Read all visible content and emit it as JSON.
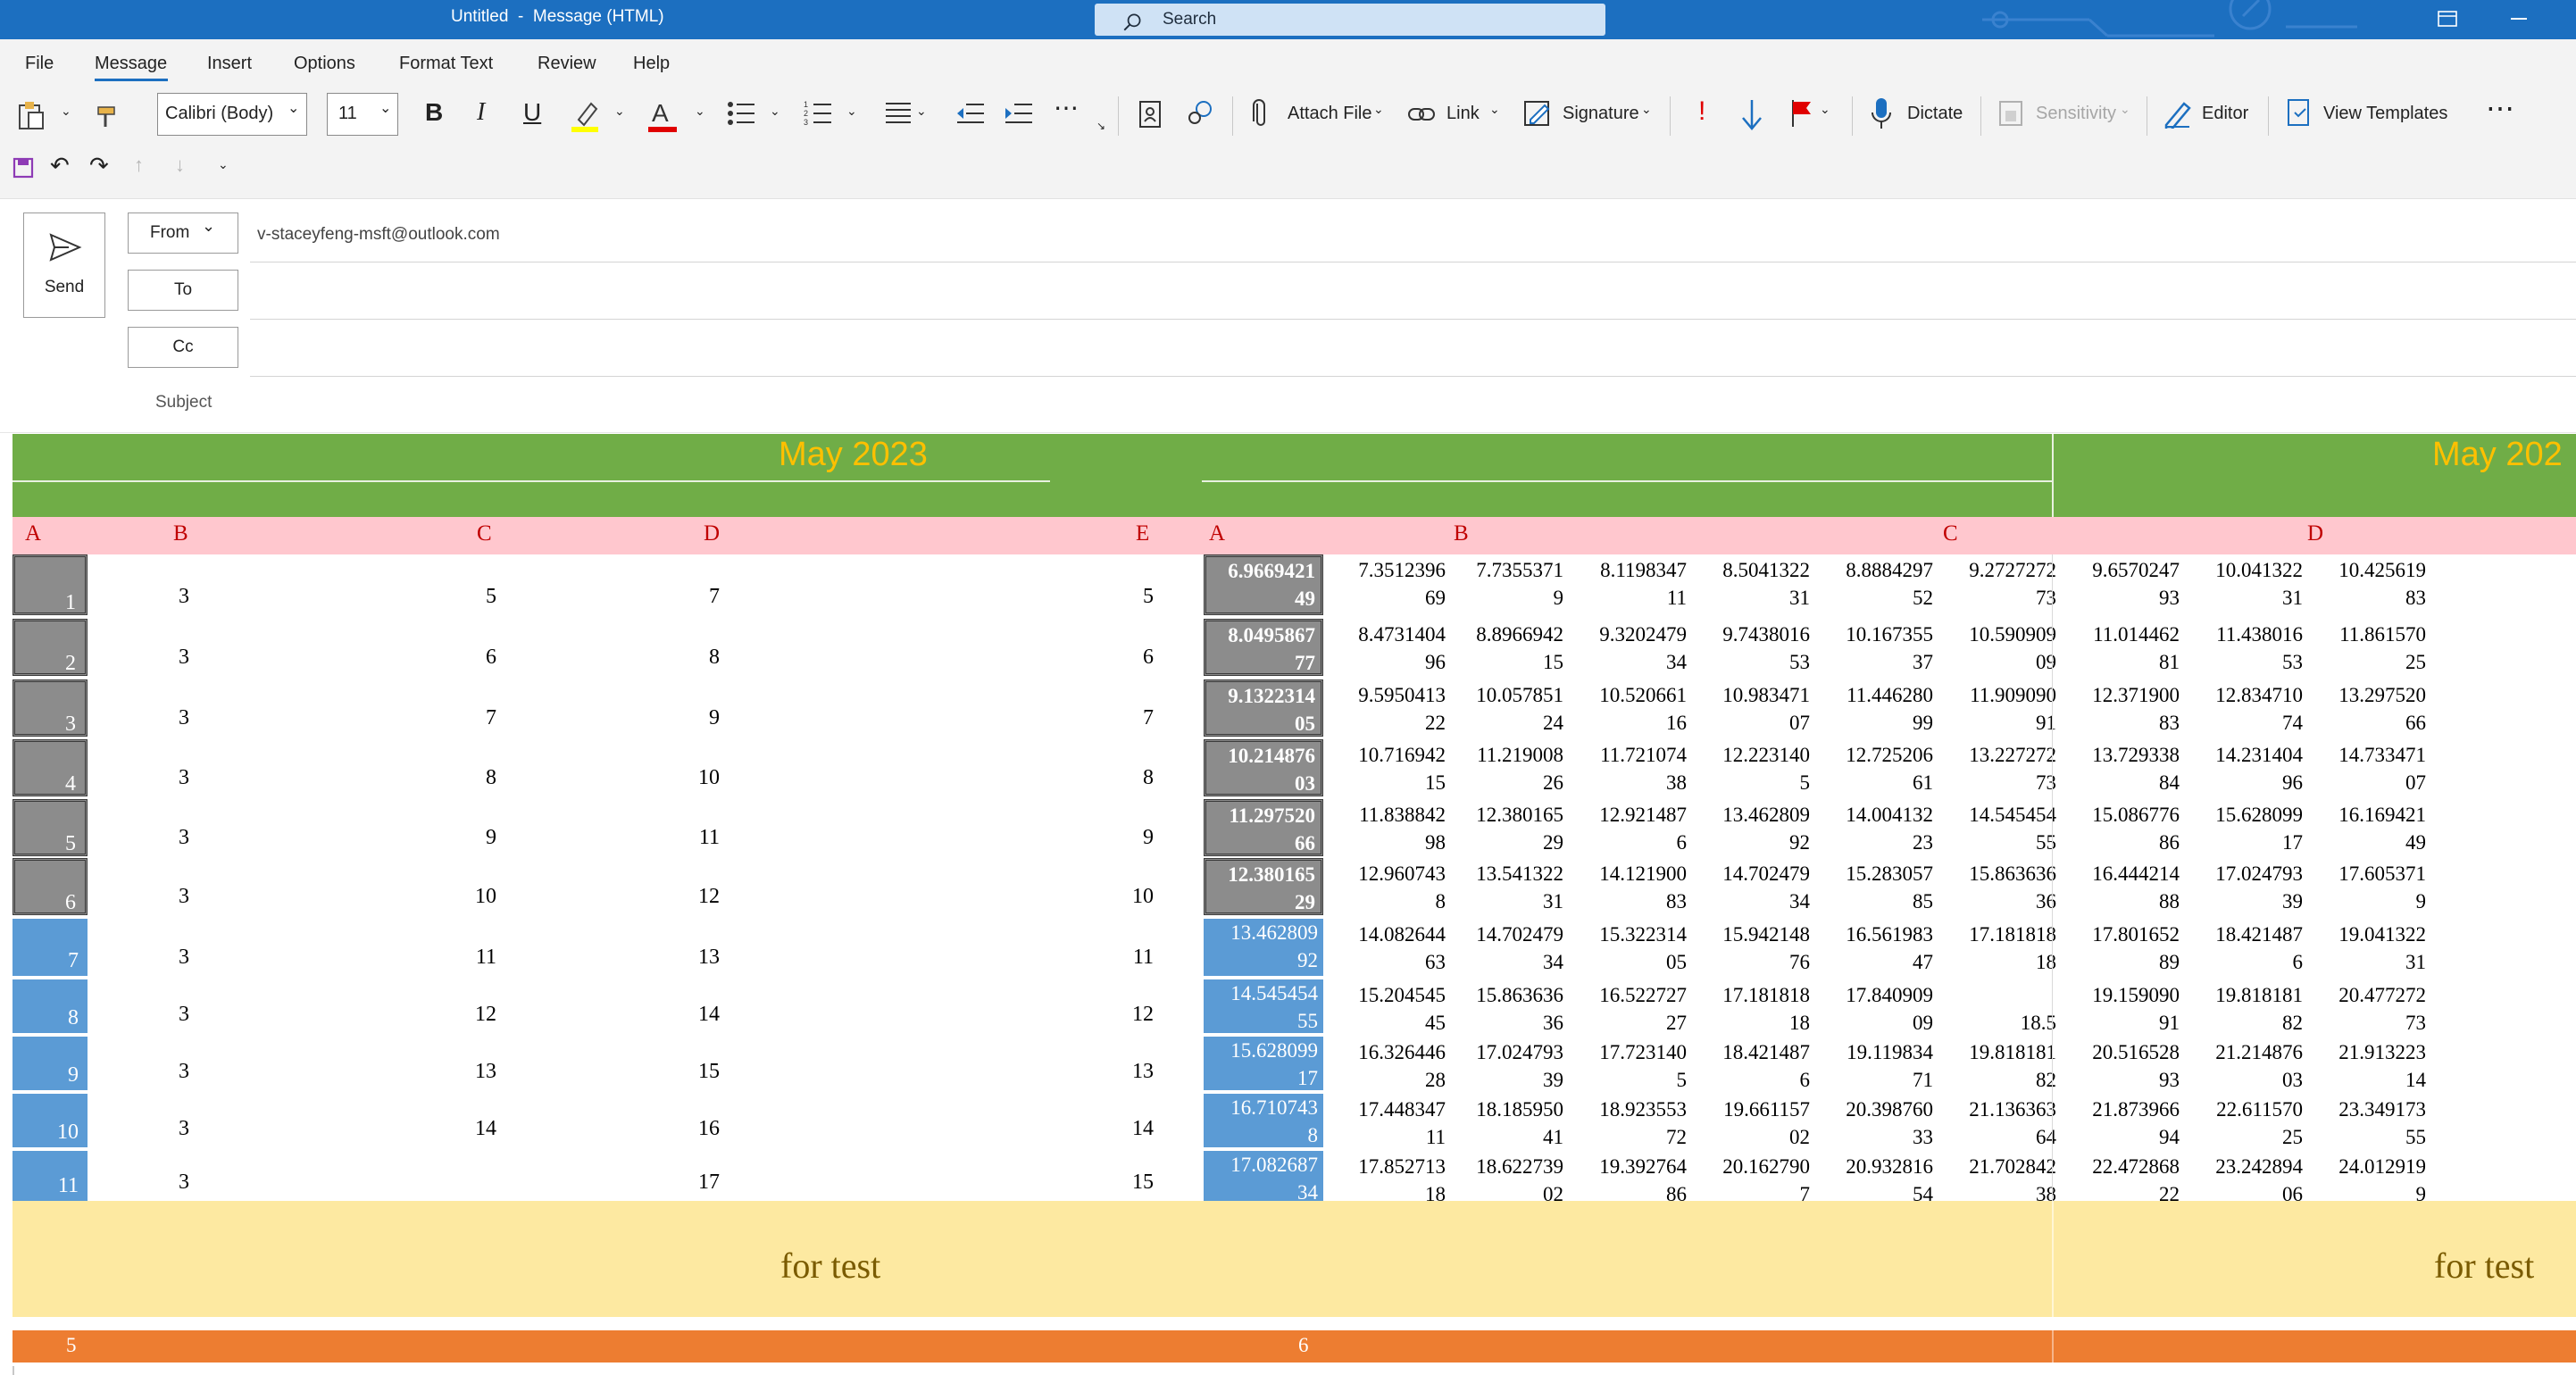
{
  "window": {
    "title": "Untitled  -  Message (HTML)",
    "search_placeholder": "Search"
  },
  "menu": [
    "File",
    "Message",
    "Insert",
    "Options",
    "Format Text",
    "Review",
    "Help"
  ],
  "ribbon": {
    "font_name": "Calibri (Body)",
    "font_size": "11",
    "attach_file": "Attach File",
    "link": "Link",
    "signature": "Signature",
    "dictate": "Dictate",
    "sensitivity": "Sensitivity",
    "editor": "Editor",
    "view_templates": "View Templates"
  },
  "compose": {
    "send": "Send",
    "from": "From",
    "from_value": "v-staceyfeng-msft@outlook.com",
    "to": "To",
    "cc": "Cc",
    "subject": "Subject"
  },
  "sheet": {
    "title_left": "May 2023",
    "title_right": "May 202",
    "footer_left": "for test",
    "footer_right": "for test",
    "orange_left": "5",
    "orange_mid": "6",
    "left_headers": [
      "A",
      "B",
      "C",
      "D",
      "E"
    ],
    "right_headers": [
      "A",
      "B",
      "C",
      "D"
    ],
    "left_rows": [
      [
        "1",
        "3",
        "5",
        "7",
        "5"
      ],
      [
        "2",
        "3",
        "6",
        "8",
        "6"
      ],
      [
        "3",
        "3",
        "7",
        "9",
        "7"
      ],
      [
        "4",
        "3",
        "8",
        "10",
        "8"
      ],
      [
        "5",
        "3",
        "9",
        "11",
        "9"
      ],
      [
        "6",
        "3",
        "10",
        "12",
        "10"
      ],
      [
        "7",
        "3",
        "11",
        "13",
        "11"
      ],
      [
        "8",
        "3",
        "12",
        "14",
        "12"
      ],
      [
        "9",
        "3",
        "13",
        "15",
        "13"
      ],
      [
        "10",
        "3",
        "14",
        "16",
        "14"
      ],
      [
        "11",
        "3",
        "",
        "17",
        "15"
      ]
    ],
    "right_a": [
      [
        "6.9669421",
        "49"
      ],
      [
        "8.0495867",
        "77"
      ],
      [
        "9.1322314",
        "05"
      ],
      [
        "10.214876",
        "03"
      ],
      [
        "11.297520",
        "66"
      ],
      [
        "12.380165",
        "29"
      ],
      [
        "13.462809",
        "92"
      ],
      [
        "14.545454",
        "55"
      ],
      [
        "15.628099",
        "17"
      ],
      [
        "16.710743",
        "8"
      ],
      [
        "17.082687",
        "34"
      ]
    ],
    "right_rows": [
      [
        [
          "7.3512396",
          "69"
        ],
        [
          "7.7355371",
          "9"
        ],
        [
          "8.1198347",
          "11"
        ],
        [
          "8.5041322",
          "31"
        ],
        [
          "8.8884297",
          "52"
        ],
        [
          "9.2727272",
          "73"
        ],
        [
          "9.6570247",
          "93"
        ],
        [
          "10.041322",
          "31"
        ],
        [
          "10.425619",
          "83"
        ]
      ],
      [
        [
          "8.4731404",
          "96"
        ],
        [
          "8.8966942",
          "15"
        ],
        [
          "9.3202479",
          "34"
        ],
        [
          "9.7438016",
          "53"
        ],
        [
          "10.167355",
          "37"
        ],
        [
          "10.590909",
          "09"
        ],
        [
          "11.014462",
          "81"
        ],
        [
          "11.438016",
          "53"
        ],
        [
          "11.861570",
          "25"
        ]
      ],
      [
        [
          "9.5950413",
          "22"
        ],
        [
          "10.057851",
          "24"
        ],
        [
          "10.520661",
          "16"
        ],
        [
          "10.983471",
          "07"
        ],
        [
          "11.446280",
          "99"
        ],
        [
          "11.909090",
          "91"
        ],
        [
          "12.371900",
          "83"
        ],
        [
          "12.834710",
          "74"
        ],
        [
          "13.297520",
          "66"
        ]
      ],
      [
        [
          "10.716942",
          "15"
        ],
        [
          "11.219008",
          "26"
        ],
        [
          "11.721074",
          "38"
        ],
        [
          "12.223140",
          "5"
        ],
        [
          "12.725206",
          "61"
        ],
        [
          "13.227272",
          "73"
        ],
        [
          "13.729338",
          "84"
        ],
        [
          "14.231404",
          "96"
        ],
        [
          "14.733471",
          "07"
        ]
      ],
      [
        [
          "11.838842",
          "98"
        ],
        [
          "12.380165",
          "29"
        ],
        [
          "12.921487",
          "6"
        ],
        [
          "13.462809",
          "92"
        ],
        [
          "14.004132",
          "23"
        ],
        [
          "14.545454",
          "55"
        ],
        [
          "15.086776",
          "86"
        ],
        [
          "15.628099",
          "17"
        ],
        [
          "16.169421",
          "49"
        ]
      ],
      [
        [
          "12.960743",
          "8"
        ],
        [
          "13.541322",
          "31"
        ],
        [
          "14.121900",
          "83"
        ],
        [
          "14.702479",
          "34"
        ],
        [
          "15.283057",
          "85"
        ],
        [
          "15.863636",
          "36"
        ],
        [
          "16.444214",
          "88"
        ],
        [
          "17.024793",
          "39"
        ],
        [
          "17.605371",
          "9"
        ]
      ],
      [
        [
          "14.082644",
          "63"
        ],
        [
          "14.702479",
          "34"
        ],
        [
          "15.322314",
          "05"
        ],
        [
          "15.942148",
          "76"
        ],
        [
          "16.561983",
          "47"
        ],
        [
          "17.181818",
          "18"
        ],
        [
          "17.801652",
          "89"
        ],
        [
          "18.421487",
          "6"
        ],
        [
          "19.041322",
          "31"
        ]
      ],
      [
        [
          "15.204545",
          "45"
        ],
        [
          "15.863636",
          "36"
        ],
        [
          "16.522727",
          "27"
        ],
        [
          "17.181818",
          "18"
        ],
        [
          "17.840909",
          "09"
        ],
        [
          "",
          "18.5"
        ],
        [
          "19.159090",
          "91"
        ],
        [
          "19.818181",
          "82"
        ],
        [
          "20.477272",
          "73"
        ]
      ],
      [
        [
          "16.326446",
          "28"
        ],
        [
          "17.024793",
          "39"
        ],
        [
          "17.723140",
          "5"
        ],
        [
          "18.421487",
          "6"
        ],
        [
          "19.119834",
          "71"
        ],
        [
          "19.818181",
          "82"
        ],
        [
          "20.516528",
          "93"
        ],
        [
          "21.214876",
          "03"
        ],
        [
          "21.913223",
          "14"
        ]
      ],
      [
        [
          "17.448347",
          "11"
        ],
        [
          "18.185950",
          "41"
        ],
        [
          "18.923553",
          "72"
        ],
        [
          "19.661157",
          "02"
        ],
        [
          "20.398760",
          "33"
        ],
        [
          "21.136363",
          "64"
        ],
        [
          "21.873966",
          "94"
        ],
        [
          "22.611570",
          "25"
        ],
        [
          "23.349173",
          "55"
        ]
      ],
      [
        [
          "17.852713",
          "18"
        ],
        [
          "18.622739",
          "02"
        ],
        [
          "19.392764",
          "86"
        ],
        [
          "20.162790",
          "7"
        ],
        [
          "20.932816",
          "54"
        ],
        [
          "21.702842",
          "38"
        ],
        [
          "22.472868",
          "22"
        ],
        [
          "23.242894",
          "06"
        ],
        [
          "24.012919",
          "9"
        ]
      ]
    ]
  },
  "colors": {
    "titlebar": "#1c6fc0",
    "green": "#70ad47",
    "pink": "#ffc7ce",
    "gray_cell": "#8c8c8c",
    "blue_cell": "#5b9bd5",
    "yellow": "#fde9a1",
    "orange": "#ed7d31",
    "gold_text": "#ffc000",
    "header_red": "#c00000"
  }
}
